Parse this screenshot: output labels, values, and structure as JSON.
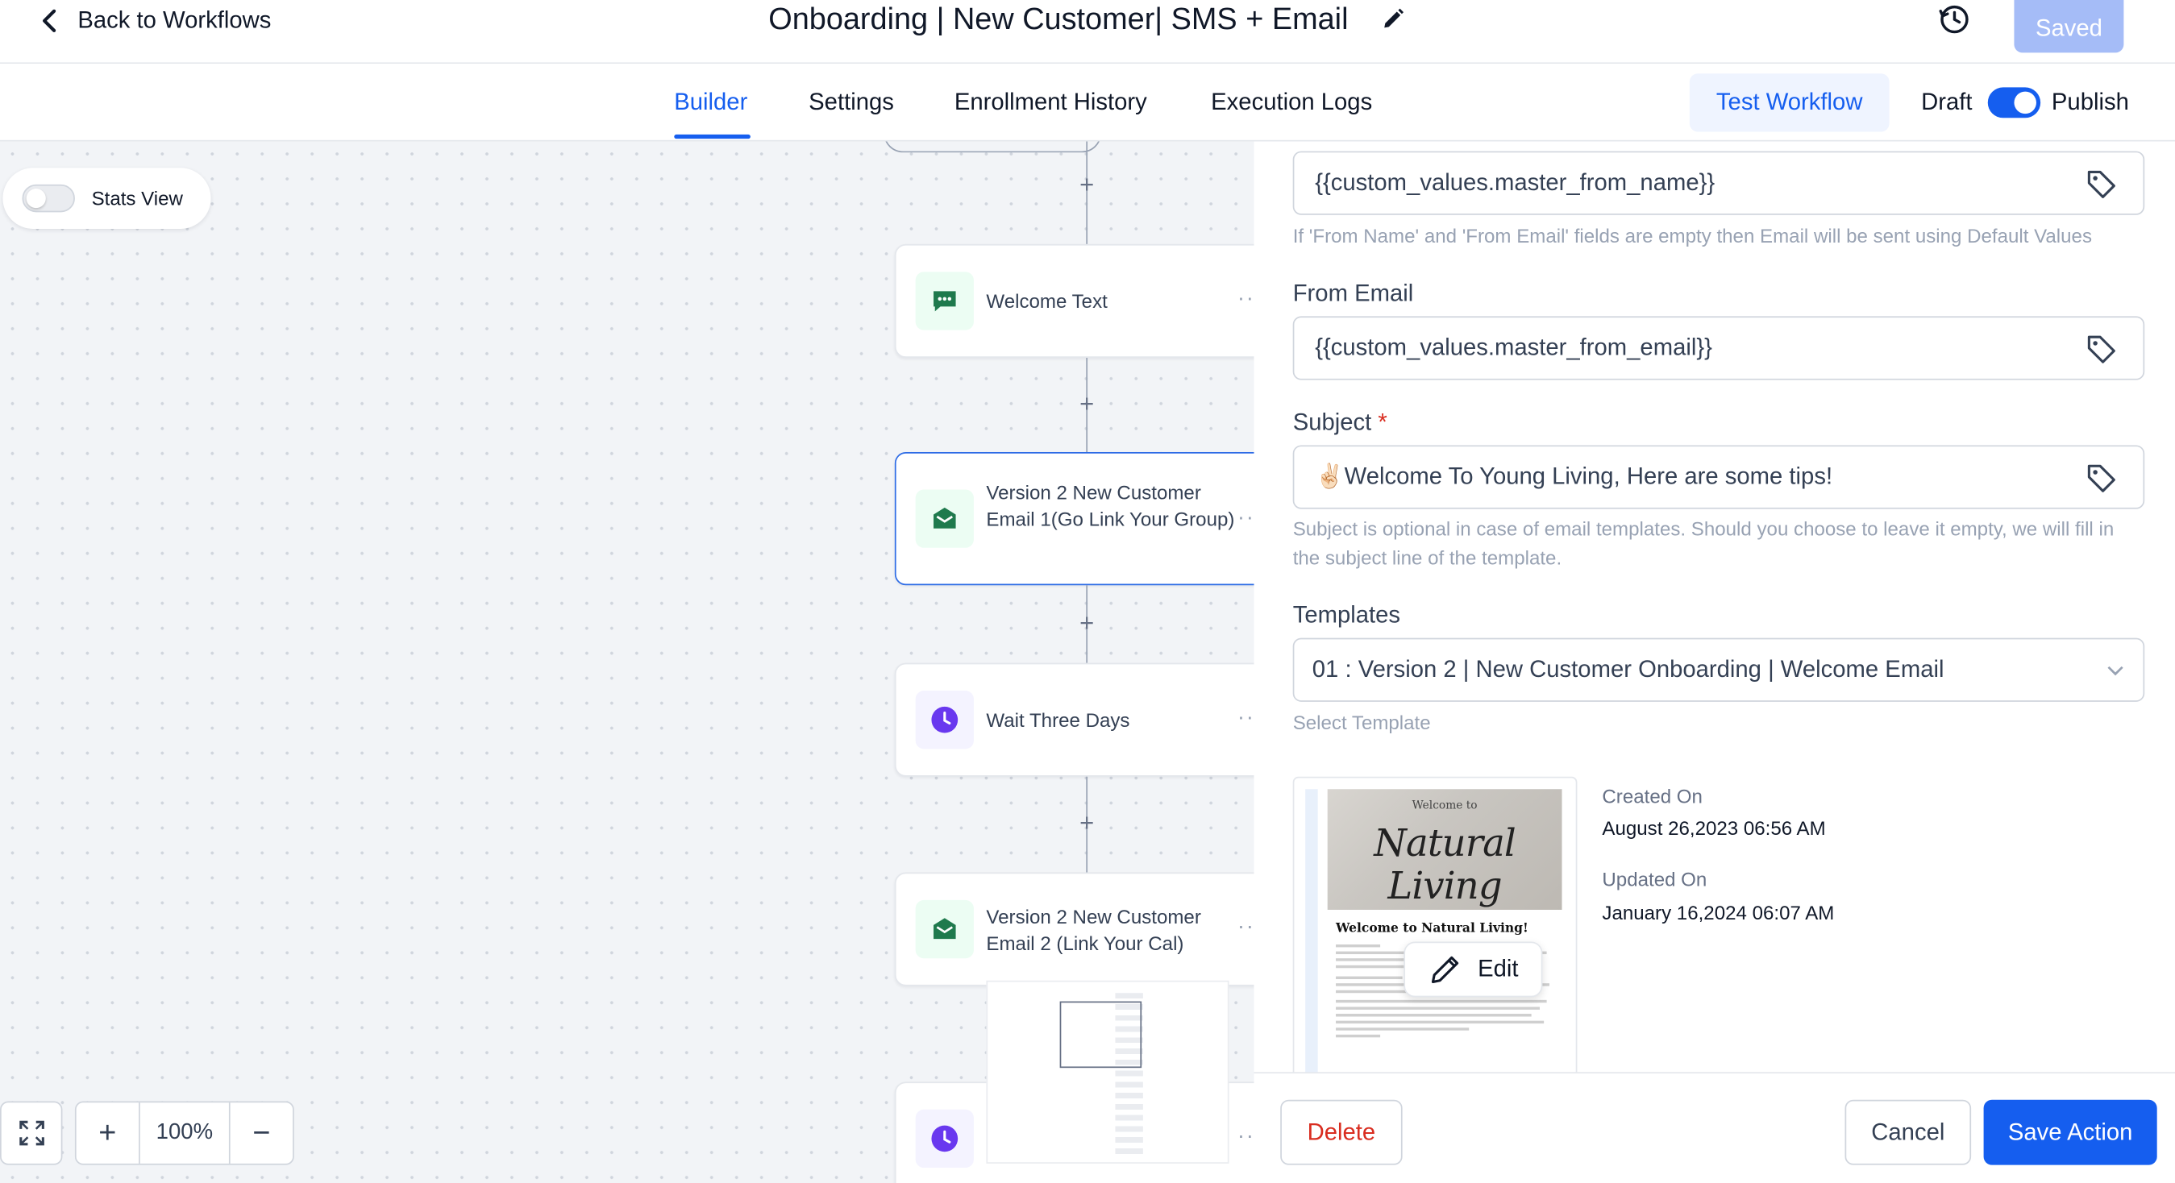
{
  "header": {
    "back_label": "Back to Workflows",
    "title": "Onboarding | New Customer| SMS + Email",
    "saved_label": "Saved"
  },
  "tabs": [
    {
      "label": "Builder",
      "active": true
    },
    {
      "label": "Settings"
    },
    {
      "label": "Enrollment History"
    },
    {
      "label": "Execution Logs"
    }
  ],
  "toolbar": {
    "test_label": "Test Workflow",
    "draft_label": "Draft",
    "publish_label": "Publish",
    "publish_enabled": true
  },
  "canvas": {
    "stats_label": "Stats View",
    "stats_enabled": false,
    "zoom": "100%",
    "nodes": [
      {
        "label": "Welcome Text",
        "icon": "message-icon",
        "color": "#1f7a4d"
      },
      {
        "label": "Version 2 New Customer Email 1(Go Link Your Group)",
        "icon": "email-icon",
        "color": "#1f7a4d",
        "selected": true
      },
      {
        "label": "Wait Three Days",
        "icon": "clock-icon",
        "color": "#6938ef"
      },
      {
        "label": "Version 2 New Customer Email 2 (Link Your Cal)",
        "icon": "email-icon",
        "color": "#1f7a4d"
      },
      {
        "label": "",
        "icon": "clock-icon",
        "color": "#6938ef"
      }
    ]
  },
  "panel": {
    "from_name_value": "{{custom_values.master_from_name}}",
    "from_name_hint": "If 'From Name' and 'From Email' fields are empty then Email will be sent using Default Values",
    "from_email_label": "From Email",
    "from_email_value": "{{custom_values.master_from_email}}",
    "subject_label": "Subject",
    "subject_required": "*",
    "subject_value": "✌🏻Welcome To Young Living, Here are some tips!",
    "subject_hint": "Subject is optional in case of email templates. Should you choose to leave it empty, we will fill in the subject line of the template.",
    "templates_label": "Templates",
    "template_value": "01  : Version 2 | New Customer Onboarding | Welcome Email",
    "template_hint": "Select Template",
    "preview": {
      "hero_small": "Welcome to",
      "hero_script": "Natural Living",
      "heading": "Welcome to Natural Living!",
      "edit_label": "Edit"
    },
    "created_label": "Created On",
    "created_value": "August 26,2023 06:56 AM",
    "updated_label": "Updated On",
    "updated_value": "January 16,2024 06:07 AM",
    "delete_label": "Delete",
    "cancel_label": "Cancel",
    "save_label": "Save Action"
  }
}
